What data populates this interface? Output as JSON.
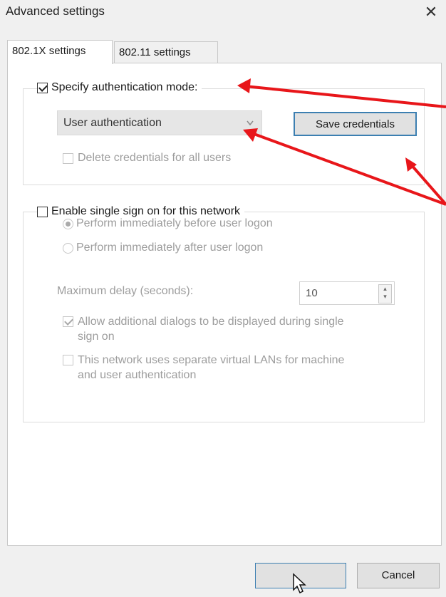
{
  "window": {
    "title": "Advanced settings",
    "close_glyph": "✕"
  },
  "tabs": [
    {
      "label": "802.1X settings",
      "active": true
    },
    {
      "label": "802.11 settings",
      "active": false
    }
  ],
  "auth": {
    "specify_mode_label": "Specify authentication mode:",
    "specify_mode_checked": true,
    "mode_selected": "User authentication",
    "save_credentials_label": "Save credentials",
    "delete_credentials_label": "Delete credentials for all users",
    "delete_credentials_checked": false
  },
  "sso": {
    "enable_label": "Enable single sign on for this network",
    "enable_checked": false,
    "radio_before_label": "Perform immediately before user logon",
    "radio_before_checked": true,
    "radio_after_label": "Perform immediately after user logon",
    "max_delay_label": "Maximum delay (seconds):",
    "max_delay_value": "10",
    "allow_dialogs_label_1": "Allow additional dialogs to be displayed during single",
    "allow_dialogs_label_2": "sign on",
    "allow_dialogs_checked": true,
    "separate_vlans_label_1": "This network uses separate virtual LANs for machine",
    "separate_vlans_label_2": "and user authentication",
    "separate_vlans_checked": false
  },
  "footer": {
    "ok_label": "",
    "cancel_label": "Cancel"
  },
  "colors": {
    "annotation_arrow": "#e8161a",
    "focus_border": "#3c7fb1"
  },
  "icons": [
    "close-icon",
    "chevron-down-icon",
    "spin-up-icon",
    "spin-down-icon",
    "mouse-cursor-icon"
  ]
}
